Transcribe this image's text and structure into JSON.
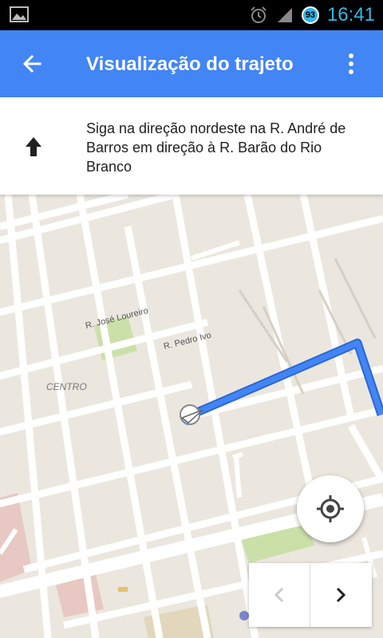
{
  "status_bar": {
    "time": "16:41",
    "battery_level": "93"
  },
  "app_bar": {
    "title": "Visualização do trajeto"
  },
  "instruction": {
    "text": "Siga na direção nordeste na R. André de Barros em direção à R. Barão do Rio Branco"
  },
  "map": {
    "street_labels": [
      "R. José Loureiro",
      "R. Pedro Ivo"
    ],
    "area_label": "CENTRO",
    "route_color": "#4285f4",
    "road_color": "#ffffff",
    "land_color": "#ebe7df",
    "park_color": "#cbe0a8"
  },
  "icons": {
    "back": "arrow-back-icon",
    "menu": "more-vert-icon",
    "direction": "arrow-up-icon",
    "locate": "my-location-icon",
    "prev": "chevron-left-icon",
    "next": "chevron-right-icon"
  },
  "colors": {
    "app_bar": "#4285f4",
    "status_accent": "#33b5e5"
  }
}
